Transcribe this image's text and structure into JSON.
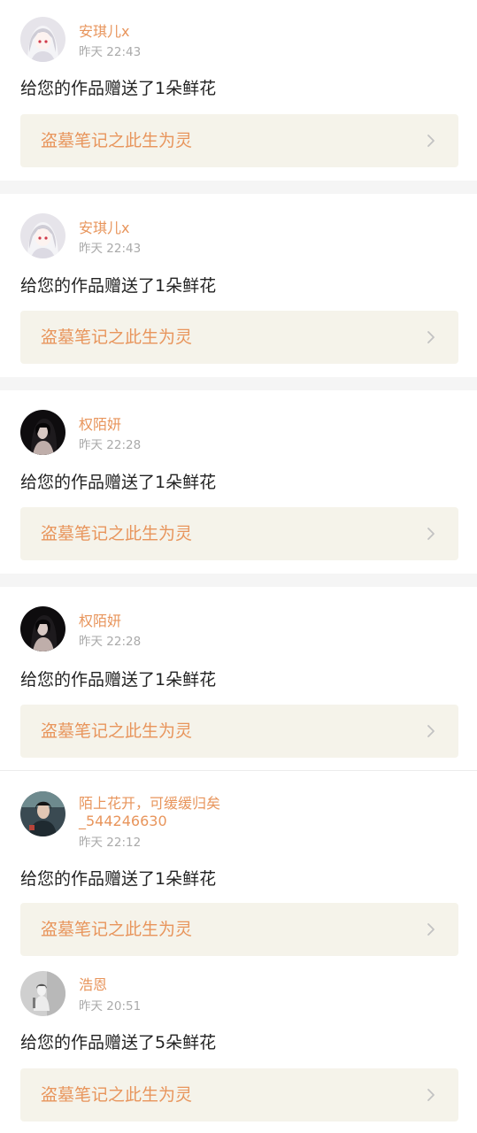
{
  "notifications": [
    {
      "user": "安琪儿x",
      "time": "昨天 22:43",
      "message": "给您的作品赠送了1朵鲜花",
      "work_title": "盗墓笔记之此生为灵",
      "avatar_icon": "anime-girl-avatar"
    },
    {
      "user": "安琪儿x",
      "time": "昨天 22:43",
      "message": "给您的作品赠送了1朵鲜花",
      "work_title": "盗墓笔记之此生为灵",
      "avatar_icon": "anime-girl-avatar"
    },
    {
      "user": "权陌妍",
      "time": "昨天 22:28",
      "message": "给您的作品赠送了1朵鲜花",
      "work_title": "盗墓笔记之此生为灵",
      "avatar_icon": "dark-portrait-avatar"
    },
    {
      "user": "权陌妍",
      "time": "昨天 22:28",
      "message": "给您的作品赠送了1朵鲜花",
      "work_title": "盗墓笔记之此生为灵",
      "avatar_icon": "dark-portrait-avatar"
    },
    {
      "user": "陌上花开，可缓缓归矣_544246630",
      "time": "昨天 22:12",
      "message": "给您的作品赠送了1朵鲜花",
      "work_title": "盗墓笔记之此生为灵",
      "avatar_icon": "boy-portrait-avatar"
    },
    {
      "user": "浩恩",
      "time": "昨天 20:51",
      "message": "给您的作品赠送了5朵鲜花",
      "work_title": "盗墓笔记之此生为灵",
      "avatar_icon": "figure-portrait-avatar"
    }
  ],
  "colors": {
    "accent": "#e8955c",
    "timestamp": "#aaaaaa",
    "message": "#222222",
    "link_bg": "#f5f3ea",
    "separator": "#f5f5f5"
  },
  "icons": {
    "chevron": "chevron-right-icon"
  }
}
